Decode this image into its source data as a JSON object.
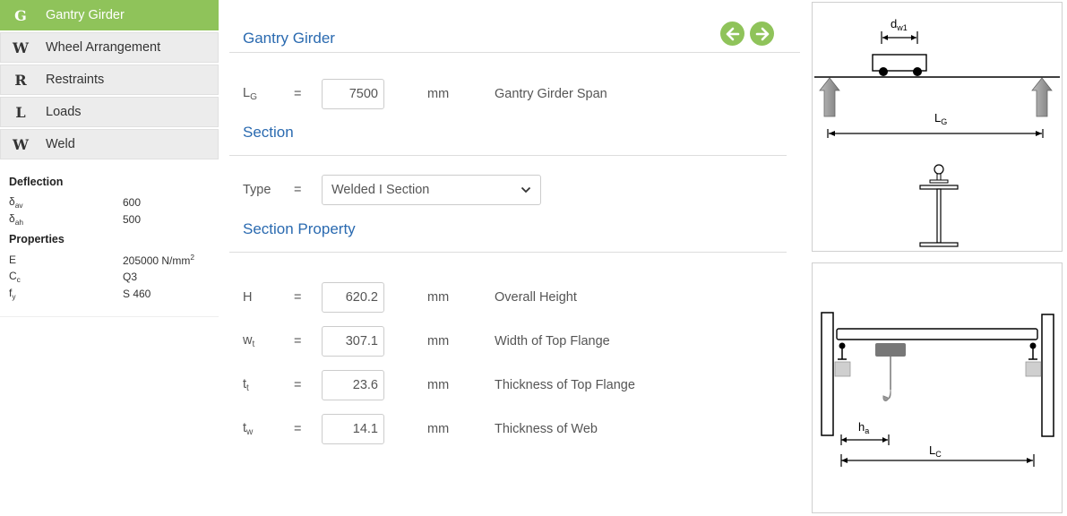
{
  "nav": [
    {
      "letter": "G",
      "label": "Gantry Girder",
      "active": true
    },
    {
      "letter": "W",
      "label": "Wheel Arrangement"
    },
    {
      "letter": "R",
      "label": "Restraints"
    },
    {
      "letter": "L",
      "label": "Loads"
    },
    {
      "letter": "W",
      "label": "Weld"
    }
  ],
  "summary": {
    "deflection_heading": "Deflection",
    "deflection": [
      {
        "sym": "δ",
        "sub": "av",
        "value": "600"
      },
      {
        "sym": "δ",
        "sub": "ah",
        "value": "500"
      }
    ],
    "properties_heading": "Properties",
    "properties": [
      {
        "sym": "E",
        "sub": "",
        "value": "205000 N/mm",
        "sup": "2"
      },
      {
        "sym": "C",
        "sub": "c",
        "value": "Q3",
        "sup": ""
      },
      {
        "sym": "f",
        "sub": "y",
        "value": "S 460",
        "sup": ""
      }
    ]
  },
  "main": {
    "title": "Gantry Girder",
    "span": {
      "sym": "L",
      "sub": "G",
      "eq": "=",
      "value": "7500",
      "unit": "mm",
      "desc": "Gantry Girder Span"
    },
    "section_title": "Section",
    "type": {
      "label": "Type",
      "eq": "=",
      "value": "Welded I Section"
    },
    "section_property_title": "Section Property",
    "properties": [
      {
        "sym": "H",
        "sub": "",
        "eq": "=",
        "value": "620.2",
        "unit": "mm",
        "desc": "Overall Height"
      },
      {
        "sym": "w",
        "sub": "t",
        "eq": "=",
        "value": "307.1",
        "unit": "mm",
        "desc": "Width of Top Flange"
      },
      {
        "sym": "t",
        "sub": "t",
        "eq": "=",
        "value": "23.6",
        "unit": "mm",
        "desc": "Thickness of Top Flange"
      },
      {
        "sym": "t",
        "sub": "w",
        "eq": "=",
        "value": "14.1",
        "unit": "mm",
        "desc": "Thickness of Web"
      }
    ]
  },
  "figures": {
    "top": {
      "dw_label": "d",
      "dw_sub": "w1",
      "lg_label": "L",
      "lg_sub": "G"
    },
    "bottom": {
      "ha_label": "h",
      "ha_sub": "a",
      "lc_label": "L",
      "lc_sub": "C"
    }
  },
  "colors": {
    "accent": "#8fc35a",
    "title_blue": "#2a6ab0",
    "nav_bg": "#ececec"
  }
}
